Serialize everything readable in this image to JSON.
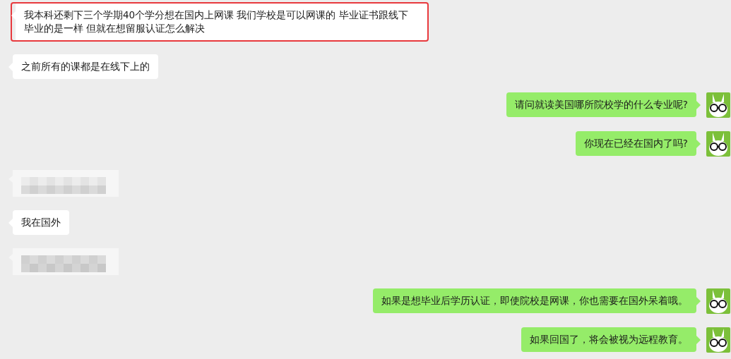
{
  "messages": [
    {
      "outgoing": false,
      "kind": "text",
      "text": "我本科还剩下三个学期40个学分想在国内上网课 我们学校是可以网课的 毕业证书跟线下毕业的是一样 但就在想留服认证怎么解决",
      "highlighted": true
    },
    {
      "outgoing": false,
      "kind": "text",
      "text": "之前所有的课都是在线下上的",
      "highlighted": false
    },
    {
      "outgoing": true,
      "kind": "text",
      "text": "请问就读美国哪所院校学的什么专业呢?",
      "highlighted": false
    },
    {
      "outgoing": true,
      "kind": "text",
      "text": "你现在已经在国内了吗?",
      "highlighted": false
    },
    {
      "outgoing": false,
      "kind": "blurred"
    },
    {
      "outgoing": false,
      "kind": "text",
      "text": "我在国外",
      "highlighted": false
    },
    {
      "outgoing": false,
      "kind": "blurred"
    },
    {
      "outgoing": true,
      "kind": "text",
      "text": "如果是想毕业后学历认证，即使院校是网课，你也需要在国外呆着哦。",
      "highlighted": false
    },
    {
      "outgoing": true,
      "kind": "text",
      "text": "如果回国了，将会被视为远程教育。",
      "highlighted": false
    }
  ]
}
